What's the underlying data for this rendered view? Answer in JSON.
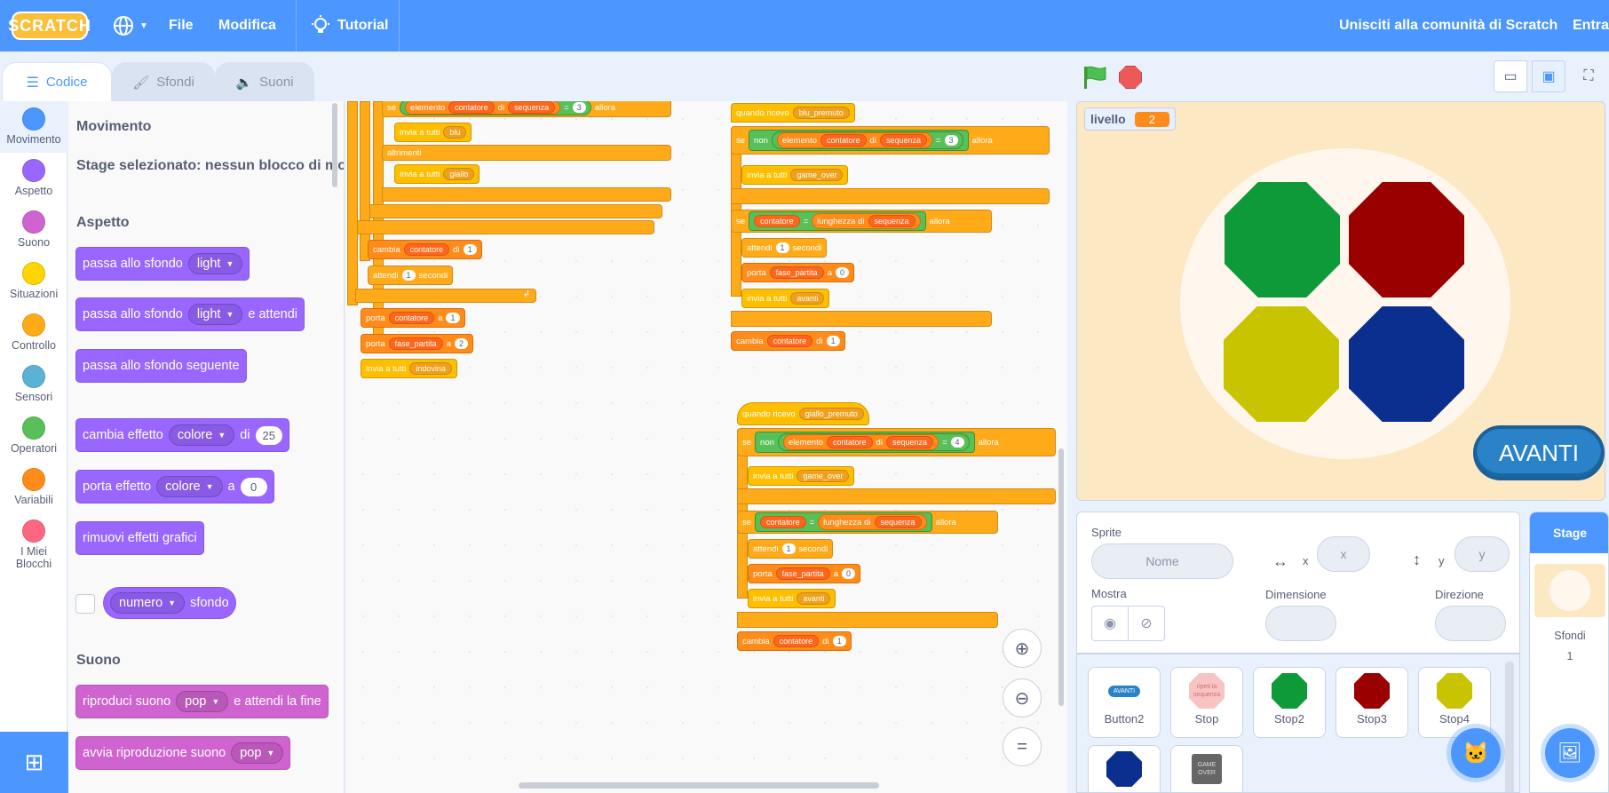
{
  "menubar": {
    "logo": "SCRATCH",
    "file": "File",
    "edit": "Modifica",
    "tutorial": "Tutorial",
    "join": "Unisciti alla comunità di Scratch",
    "signin": "Entra"
  },
  "tabs": {
    "code": "Codice",
    "backdrops": "Sfondi",
    "sounds": "Suoni"
  },
  "categories": [
    {
      "label": "Movimento",
      "color": "#4c97ff"
    },
    {
      "label": "Aspetto",
      "color": "#9966ff"
    },
    {
      "label": "Suono",
      "color": "#cf63cf"
    },
    {
      "label": "Situazioni",
      "color": "#ffd500"
    },
    {
      "label": "Controllo",
      "color": "#ffab19"
    },
    {
      "label": "Sensori",
      "color": "#5cb1d6"
    },
    {
      "label": "Operatori",
      "color": "#59c059"
    },
    {
      "label": "Variabili",
      "color": "#ff8c1a"
    },
    {
      "label": "I Miei Blocchi",
      "color": "#ff6680"
    }
  ],
  "palette": {
    "motion_header": "Movimento",
    "motion_note": "Stage selezionato: nessun blocco di mo",
    "looks_header": "Aspetto",
    "b1": {
      "text": "passa allo sfondo",
      "dd": "light"
    },
    "b2": {
      "text": "passa allo sfondo",
      "dd": "light",
      "tail": "e attendi"
    },
    "b3": {
      "text": "passa allo sfondo seguente"
    },
    "b4": {
      "text": "cambia effetto",
      "dd": "colore",
      "mid": "di",
      "num": "25"
    },
    "b5": {
      "text": "porta effetto",
      "dd": "colore",
      "mid": "a",
      "num": "0"
    },
    "b6": {
      "text": "rimuovi effetti grafici"
    },
    "b7": {
      "dd": "numero",
      "tail": "sfondo"
    },
    "sound_header": "Suono",
    "s1": {
      "text": "riproduci suono",
      "dd": "pop",
      "tail": "e attendi la fine"
    },
    "s2": {
      "text": "avvia riproduzione suono",
      "dd": "pop"
    }
  },
  "script1": {
    "se": "se",
    "elemento": "elemento",
    "contatore": "contatore",
    "di": "di",
    "sequenza": "sequenza",
    "eq": "=",
    "n3": "3",
    "allora": "allora",
    "invia_blu": "invia a tutti",
    "blu": "blu",
    "altrimenti": "altrimenti",
    "invia_giallo": "invia a tutti",
    "giallo": "giallo",
    "cambia": "cambia",
    "cambia_var": "contatore",
    "cambia_di": "di",
    "cambia_n": "1",
    "attendi": "attendi",
    "attendi_n": "1",
    "secondi": "secondi",
    "porta1": "porta",
    "porta1_var": "contatore",
    "porta1_a": "a",
    "porta1_n": "1",
    "porta2": "porta",
    "porta2_var": "fase_partita",
    "porta2_a": "a",
    "porta2_n": "2",
    "invia_ind": "invia a tutti",
    "indovina": "indovina"
  },
  "script2": {
    "hat": "quando ricevo",
    "msg": "blu_premuto",
    "se": "se",
    "non": "non",
    "elemento": "elemento",
    "contatore": "contatore",
    "di": "di",
    "sequenza": "sequenza",
    "eq": "=",
    "n": "3",
    "allora": "allora",
    "invia_go": "invia a tutti",
    "game_over": "game_over",
    "se2": "se",
    "contatore2": "contatore",
    "eq2": "=",
    "lunghezza": "lunghezza di",
    "sequenza2": "sequenza",
    "allora2": "allora",
    "attendi": "attendi",
    "attendi_n": "1",
    "secondi": "secondi",
    "porta": "porta",
    "porta_var": "fase_partita",
    "porta_a": "a",
    "porta_n": "0",
    "invia_av": "invia a tutti",
    "avanti": "avanti",
    "cambia": "cambia",
    "cambia_var": "contatore",
    "cambia_di": "di",
    "cambia_n": "1"
  },
  "script3": {
    "hat": "quando ricevo",
    "msg": "giallo_premuto",
    "se": "se",
    "non": "non",
    "elemento": "elemento",
    "contatore": "contatore",
    "di": "di",
    "sequenza": "sequenza",
    "eq": "=",
    "n": "4",
    "allora": "allora",
    "invia_go": "invia a tutti",
    "game_over": "game_over",
    "se2": "se",
    "contatore2": "contatore",
    "eq2": "=",
    "lunghezza": "lunghezza di",
    "sequenza2": "sequenza",
    "allora2": "allora",
    "attendi": "attendi",
    "attendi_n": "1",
    "secondi": "secondi",
    "porta": "porta",
    "porta_var": "fase_partita",
    "porta_a": "a",
    "porta_n": "0",
    "invia_av": "invia a tutti",
    "avanti": "avanti",
    "cambia": "cambia",
    "cambia_var": "contatore",
    "cambia_di": "di",
    "cambia_n": "1"
  },
  "stage": {
    "monitor_label": "livello",
    "monitor_value": "2",
    "button": "AVANTI"
  },
  "sprite_info": {
    "sprite_label": "Sprite",
    "name_placeholder": "Nome",
    "x_label": "x",
    "x_placeholder": "x",
    "y_label": "y",
    "y_placeholder": "y",
    "show_label": "Mostra",
    "size_label": "Dimensione",
    "direction_label": "Direzione"
  },
  "sprites": [
    {
      "name": "Button2"
    },
    {
      "name": "Stop",
      "thumb_text": "ripeti la sequenza"
    },
    {
      "name": "Stop2",
      "color": "#0f9a3a"
    },
    {
      "name": "Stop3",
      "color": "#9b0000"
    },
    {
      "name": "Stop4",
      "color": "#c9c400"
    },
    {
      "name": "",
      "color": "#0a2f8f"
    },
    {
      "name": "",
      "thumb_text": "GAME OVER"
    }
  ],
  "stage_panel": {
    "title": "Stage",
    "backdrops_label": "Sfondi",
    "backdrops_count": "1"
  }
}
